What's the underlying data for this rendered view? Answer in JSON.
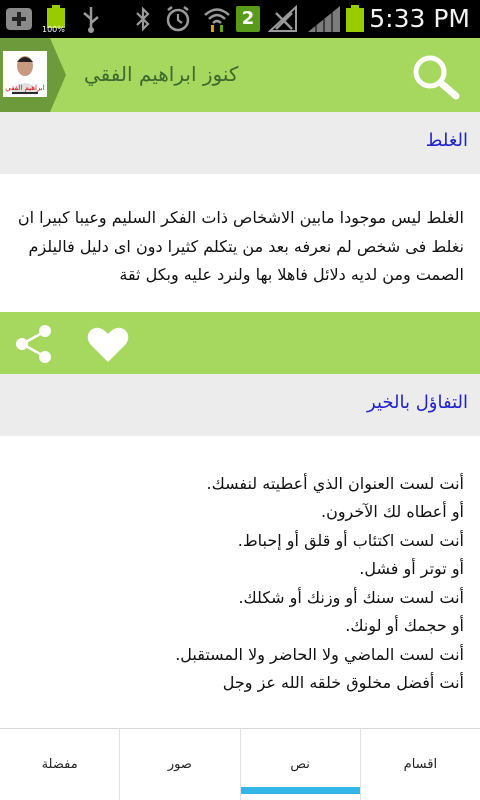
{
  "status_bar": {
    "battery_percent": "100%",
    "notification_count": "2",
    "time": "5:33 PM"
  },
  "app": {
    "title": "كنوز ابراهيم الفقي",
    "icon_caption": "ابراهيم الفقي"
  },
  "posts": [
    {
      "title": "الغلط",
      "body": "الغلط ليس موجودا مابين الاشخاص ذات الفكر السليم وعيبا كبيرا ان نغلط فى شخص لم نعرفه بعد من يتكلم كثيرا دون اى دليل فاليلزم الصمت ومن لديه دلائل فاهلا بها ولنرد عليه وبكل ثقة"
    },
    {
      "title": "التفاؤل بالخير",
      "lines": [
        "أنت لست العنوان الذي أعطيته لنفسك.",
        "أو أعطاه لك الآخرون.",
        "أنت لست اكتئاب أو قلق أو إحباط.",
        "أو توتر أو فشل.",
        "أنت لست سنك أو وزنك أو شكلك.",
        "أو حجمك أو لونك.",
        "أنت لست الماضي ولا الحاضر ولا المستقبل.",
        "أنت أفضل مخلوق خلقه الله عز وجل"
      ]
    }
  ],
  "tabs": [
    {
      "label": "مفضلة",
      "active": false
    },
    {
      "label": "صور",
      "active": false
    },
    {
      "label": "نص",
      "active": true
    },
    {
      "label": "اقسام",
      "active": false
    }
  ]
}
